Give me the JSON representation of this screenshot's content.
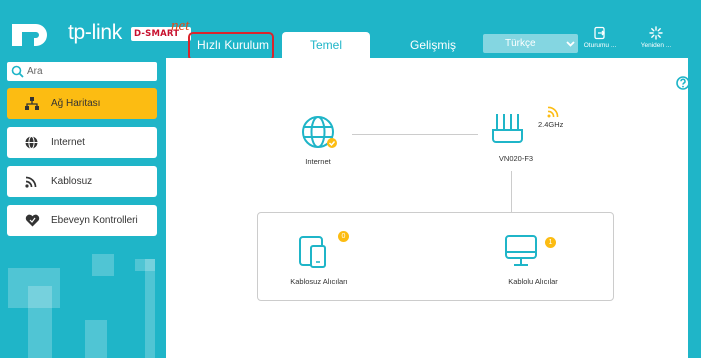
{
  "header": {
    "logo_text": "tp-link",
    "brand_name": "D-SMART",
    "brand_script": "net",
    "tabs": [
      {
        "label": "Hızlı Kurulum"
      },
      {
        "label": "Temel"
      },
      {
        "label": "Gelişmiş"
      }
    ],
    "language": "Türkçe",
    "logout_label": "Oturumu ...",
    "reboot_label": "Yeniden ..."
  },
  "sidebar": {
    "search_placeholder": "Ara",
    "items": [
      {
        "label": "Ağ Haritası",
        "icon": "network-map-icon"
      },
      {
        "label": "Internet",
        "icon": "globe-icon"
      },
      {
        "label": "Kablosuz",
        "icon": "wifi-icon"
      },
      {
        "label": "Ebeveyn Kontrolleri",
        "icon": "heart-icon"
      }
    ]
  },
  "main": {
    "internet_label": "Internet",
    "router_label": "VN020-F3",
    "band_label": "2.4GHz",
    "wireless_clients_label": "Kablosuz Alıcıları",
    "wireless_clients_count": "0",
    "wired_clients_label": "Kablolu Alıcılar",
    "wired_clients_count": "1"
  },
  "colors": {
    "primary": "#1fb5c8",
    "accent": "#fcbc12",
    "highlight": "#d9252d"
  }
}
